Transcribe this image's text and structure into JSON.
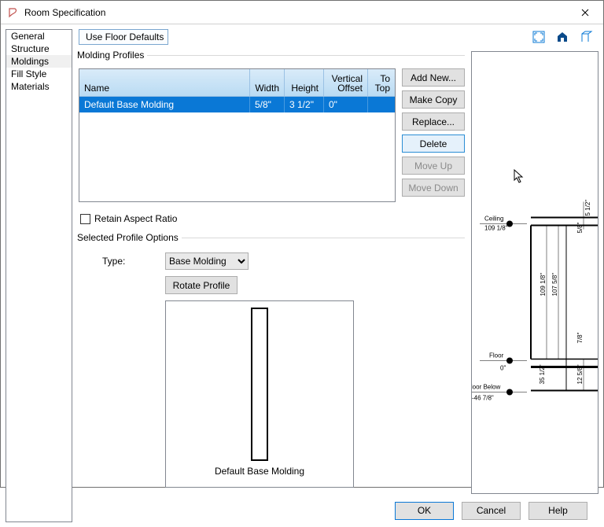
{
  "window": {
    "title": "Room Specification"
  },
  "sidebar": {
    "items": [
      {
        "label": "General"
      },
      {
        "label": "Structure"
      },
      {
        "label": "Moldings",
        "active": true
      },
      {
        "label": "Fill Style"
      },
      {
        "label": "Materials"
      }
    ]
  },
  "floor_defaults": {
    "label": "Use Floor Defaults",
    "checked": false
  },
  "profiles": {
    "legend": "Molding Profiles",
    "columns": [
      "Name",
      "Width",
      "Height",
      "Vertical Offset",
      "To Top"
    ],
    "rows": [
      {
        "name": "Default Base Molding",
        "width": "5/8\"",
        "height": "3 1/2\"",
        "voffset": "0\"",
        "totop": ""
      }
    ],
    "buttons": {
      "add": "Add New...",
      "copy": "Make Copy",
      "replace": "Replace...",
      "delete": "Delete",
      "moveup": "Move Up",
      "movedown": "Move Down"
    }
  },
  "aspect": {
    "label": "Retain Aspect Ratio",
    "checked": false
  },
  "selected_options": {
    "legend": "Selected Profile Options",
    "type_label": "Type:",
    "type_value": "Base Molding",
    "rotate_label": "Rotate Profile"
  },
  "preview": {
    "caption": "Default Base Molding"
  },
  "section_labels": {
    "ceiling": "Ceiling",
    "floor": "Floor",
    "floor_below": "Floor Below",
    "ceiling_val": "109 1/8\"",
    "floor_val": "0\"",
    "floor_below_val": "-46 7/8\"",
    "dim_a": "109 1/8\"",
    "dim_b": "107 5/8\"",
    "dim_c": "5 1/2\"",
    "dim_d": "7/8\"",
    "dim_e": "12 5/8\"",
    "dim_f": "5/8\"",
    "dim_g": "35 1/2\""
  },
  "footer": {
    "ok": "OK",
    "cancel": "Cancel",
    "help": "Help"
  }
}
